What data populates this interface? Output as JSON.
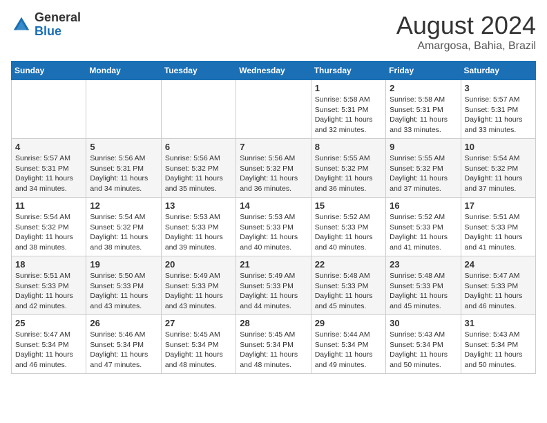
{
  "logo": {
    "general": "General",
    "blue": "Blue"
  },
  "title": {
    "month_year": "August 2024",
    "location": "Amargosa, Bahia, Brazil"
  },
  "weekdays": [
    "Sunday",
    "Monday",
    "Tuesday",
    "Wednesday",
    "Thursday",
    "Friday",
    "Saturday"
  ],
  "weeks": [
    [
      {
        "day": "",
        "info": ""
      },
      {
        "day": "",
        "info": ""
      },
      {
        "day": "",
        "info": ""
      },
      {
        "day": "",
        "info": ""
      },
      {
        "day": "1",
        "info": "Sunrise: 5:58 AM\nSunset: 5:31 PM\nDaylight: 11 hours\nand 32 minutes."
      },
      {
        "day": "2",
        "info": "Sunrise: 5:58 AM\nSunset: 5:31 PM\nDaylight: 11 hours\nand 33 minutes."
      },
      {
        "day": "3",
        "info": "Sunrise: 5:57 AM\nSunset: 5:31 PM\nDaylight: 11 hours\nand 33 minutes."
      }
    ],
    [
      {
        "day": "4",
        "info": "Sunrise: 5:57 AM\nSunset: 5:31 PM\nDaylight: 11 hours\nand 34 minutes."
      },
      {
        "day": "5",
        "info": "Sunrise: 5:56 AM\nSunset: 5:31 PM\nDaylight: 11 hours\nand 34 minutes."
      },
      {
        "day": "6",
        "info": "Sunrise: 5:56 AM\nSunset: 5:32 PM\nDaylight: 11 hours\nand 35 minutes."
      },
      {
        "day": "7",
        "info": "Sunrise: 5:56 AM\nSunset: 5:32 PM\nDaylight: 11 hours\nand 36 minutes."
      },
      {
        "day": "8",
        "info": "Sunrise: 5:55 AM\nSunset: 5:32 PM\nDaylight: 11 hours\nand 36 minutes."
      },
      {
        "day": "9",
        "info": "Sunrise: 5:55 AM\nSunset: 5:32 PM\nDaylight: 11 hours\nand 37 minutes."
      },
      {
        "day": "10",
        "info": "Sunrise: 5:54 AM\nSunset: 5:32 PM\nDaylight: 11 hours\nand 37 minutes."
      }
    ],
    [
      {
        "day": "11",
        "info": "Sunrise: 5:54 AM\nSunset: 5:32 PM\nDaylight: 11 hours\nand 38 minutes."
      },
      {
        "day": "12",
        "info": "Sunrise: 5:54 AM\nSunset: 5:32 PM\nDaylight: 11 hours\nand 38 minutes."
      },
      {
        "day": "13",
        "info": "Sunrise: 5:53 AM\nSunset: 5:33 PM\nDaylight: 11 hours\nand 39 minutes."
      },
      {
        "day": "14",
        "info": "Sunrise: 5:53 AM\nSunset: 5:33 PM\nDaylight: 11 hours\nand 40 minutes."
      },
      {
        "day": "15",
        "info": "Sunrise: 5:52 AM\nSunset: 5:33 PM\nDaylight: 11 hours\nand 40 minutes."
      },
      {
        "day": "16",
        "info": "Sunrise: 5:52 AM\nSunset: 5:33 PM\nDaylight: 11 hours\nand 41 minutes."
      },
      {
        "day": "17",
        "info": "Sunrise: 5:51 AM\nSunset: 5:33 PM\nDaylight: 11 hours\nand 41 minutes."
      }
    ],
    [
      {
        "day": "18",
        "info": "Sunrise: 5:51 AM\nSunset: 5:33 PM\nDaylight: 11 hours\nand 42 minutes."
      },
      {
        "day": "19",
        "info": "Sunrise: 5:50 AM\nSunset: 5:33 PM\nDaylight: 11 hours\nand 43 minutes."
      },
      {
        "day": "20",
        "info": "Sunrise: 5:49 AM\nSunset: 5:33 PM\nDaylight: 11 hours\nand 43 minutes."
      },
      {
        "day": "21",
        "info": "Sunrise: 5:49 AM\nSunset: 5:33 PM\nDaylight: 11 hours\nand 44 minutes."
      },
      {
        "day": "22",
        "info": "Sunrise: 5:48 AM\nSunset: 5:33 PM\nDaylight: 11 hours\nand 45 minutes."
      },
      {
        "day": "23",
        "info": "Sunrise: 5:48 AM\nSunset: 5:33 PM\nDaylight: 11 hours\nand 45 minutes."
      },
      {
        "day": "24",
        "info": "Sunrise: 5:47 AM\nSunset: 5:33 PM\nDaylight: 11 hours\nand 46 minutes."
      }
    ],
    [
      {
        "day": "25",
        "info": "Sunrise: 5:47 AM\nSunset: 5:34 PM\nDaylight: 11 hours\nand 46 minutes."
      },
      {
        "day": "26",
        "info": "Sunrise: 5:46 AM\nSunset: 5:34 PM\nDaylight: 11 hours\nand 47 minutes."
      },
      {
        "day": "27",
        "info": "Sunrise: 5:45 AM\nSunset: 5:34 PM\nDaylight: 11 hours\nand 48 minutes."
      },
      {
        "day": "28",
        "info": "Sunrise: 5:45 AM\nSunset: 5:34 PM\nDaylight: 11 hours\nand 48 minutes."
      },
      {
        "day": "29",
        "info": "Sunrise: 5:44 AM\nSunset: 5:34 PM\nDaylight: 11 hours\nand 49 minutes."
      },
      {
        "day": "30",
        "info": "Sunrise: 5:43 AM\nSunset: 5:34 PM\nDaylight: 11 hours\nand 50 minutes."
      },
      {
        "day": "31",
        "info": "Sunrise: 5:43 AM\nSunset: 5:34 PM\nDaylight: 11 hours\nand 50 minutes."
      }
    ]
  ]
}
